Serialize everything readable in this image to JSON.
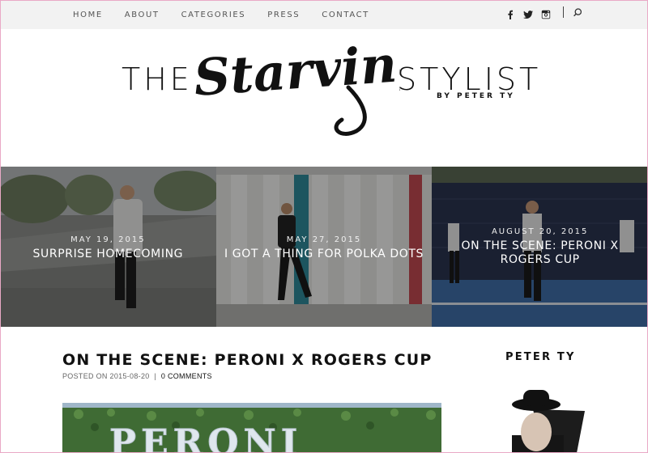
{
  "nav": {
    "items": [
      {
        "label": "HOME"
      },
      {
        "label": "ABOUT"
      },
      {
        "label": "CATEGORIES"
      },
      {
        "label": "PRESS"
      },
      {
        "label": "CONTACT"
      }
    ],
    "social_icons": [
      "facebook-icon",
      "twitter-icon",
      "instagram-icon"
    ],
    "search_icon": "search-icon"
  },
  "logo": {
    "left_word": "THE",
    "script_word": "Starving",
    "right_word": "STYLIST",
    "byline": "BY PETER TY"
  },
  "featured": [
    {
      "date": "MAY 19, 2015",
      "title": "SURPRISE HOMECOMING"
    },
    {
      "date": "MAY 27, 2015",
      "title": "I GOT A THING FOR POLKA DOTS"
    },
    {
      "date": "AUGUST 20, 2015",
      "title": "ON THE SCENE: PERONI X ROGERS CUP"
    }
  ],
  "post": {
    "title": "ON THE SCENE: PERONI X ROGERS CUP",
    "posted_prefix": "POSTED ON",
    "date": "2015-08-20",
    "separator": "|",
    "comments": "0 COMMENTS",
    "image_text": "PERONI"
  },
  "sidebar": {
    "title": "PETER TY"
  },
  "colors": {
    "topbar": "#f2f2f2",
    "frame": "#e9a9c6",
    "text": "#111111"
  }
}
